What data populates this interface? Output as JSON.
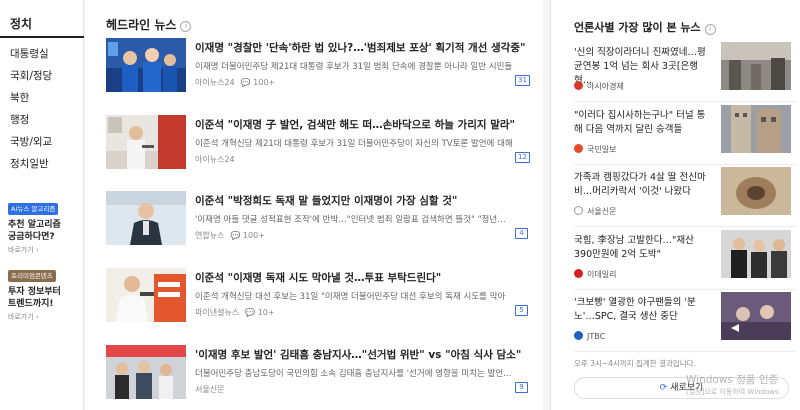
{
  "sidebar": {
    "title": "정치",
    "items": [
      "대통령실",
      "국회/정당",
      "북한",
      "행정",
      "국방/외교",
      "정치일반"
    ],
    "promos": [
      {
        "tag": "AI뉴스 알고리즘",
        "text_line1": "추천 알고리즘",
        "text_line2": "궁금하다면?",
        "more": "바로가기 ›"
      },
      {
        "tag": "프리미엄콘텐츠",
        "text_line1": "투자 정보부터",
        "text_line2": "트렌드까지!",
        "more": "바로가기 ›"
      }
    ]
  },
  "headline": {
    "title": "헤드라인 뉴스",
    "items": [
      {
        "title": "이재명 \"경찰만 '단속'하란 법 있나?…'범죄제보 포상' 획기적 개선 생각중\"",
        "summary": "이재명 더불어민주당 제21대 대통령 후보가 31일 범죄 단속에 경찰뿐 아니라 일반 시민들",
        "press": "아이뉴스24",
        "comments": "100+",
        "count": "31"
      },
      {
        "title": "이준석 \"이재명 子 발언, 검색만 해도 떠…손바닥으로 하늘 가리지 말라\"",
        "summary": "이준석 개혁신당 제21대 대통령 후보가 31일 더불어민주당이 자신의 TV토론 발언에 대해",
        "press": "아이뉴스24",
        "comments": "",
        "count": "12"
      },
      {
        "title": "이준석 \"박정희도 독재 말 들었지만 이재명이 가장 심할 것\"",
        "summary": "'이재명 아들 댓글 성적표현 조작'에 반박…\"인터넷 범죄 일람표 검색하면 뜰것\" \"정년…",
        "press": "연합뉴스",
        "comments": "100+",
        "count": "4"
      },
      {
        "title": "이준석 \"이재명 독재 시도 막아낼 것…투표 부탁드린다\"",
        "summary": "이준석 개혁신당 대선 후보는 31일 \"이재명 더불어민주당 대선 후보의 독재 시도를 막아",
        "press": "파이낸셜뉴스",
        "comments": "10+",
        "count": "5"
      },
      {
        "title": "'이재명 후보 발언' 김태흠 충남지사…\"선거법 위반\" vs \"아침 식사 담소\"",
        "summary": "더불어민주당 충남도당이 국민의힘 소속 김태흠 충남지사를 '선거에 영향을 미치는 발언…",
        "press": "서울신문",
        "comments": "",
        "count": "9"
      }
    ]
  },
  "ranking": {
    "title": "언론사별 가장 많이 본 뉴스",
    "items": [
      {
        "title": "'신의 직장이라더니 진짜였네…평균연봉 1억 넘는 회사 3곳[은행현…",
        "press": "아시아경제",
        "color": "#d83a2a"
      },
      {
        "title": "\"이러다 집시사하는구나\" 터널 통해 다음 역까지 달린 승객들",
        "press": "국민일보",
        "color": "#e84b2a"
      },
      {
        "title": "가족과 캠핑갔다가 4살 딸 전신마비…머리카락서 '이것' 나왔다",
        "press": "서울신문",
        "color": "#ffffff"
      },
      {
        "title": "국힘, 李장남 고발한다…\"재산 390만원에 2억 도박\"",
        "press": "이데일리",
        "color": "#d42020"
      },
      {
        "title": "'크보빵' 열광한 야구팬들의 '분노'…SPC, 결국 생산 중단",
        "press": "JTBC",
        "color": "#1f5fbf"
      }
    ],
    "footer": "오후 3시~4시까지 집계한 결과입니다.",
    "refresh": "새로보기"
  },
  "watermark": {
    "line1": "Windows 정품 인증",
    "line2": "[설정]으로 이동하여 Windows"
  }
}
